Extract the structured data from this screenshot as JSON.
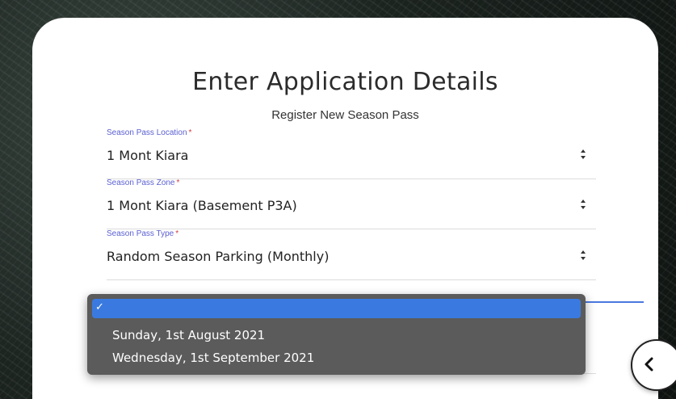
{
  "form": {
    "title": "Enter Application Details",
    "subtitle": "Register New Season Pass",
    "required_marker": "*",
    "fields": [
      {
        "label": "Season Pass Location",
        "value": "1 Mont Kiara"
      },
      {
        "label": "Season Pass Zone",
        "value": "1 Mont Kiara (Basement P3A)"
      },
      {
        "label": "Season Pass Type",
        "value": "Random Season Parking (Monthly)"
      }
    ]
  },
  "dropdown": {
    "check_mark": "✓",
    "options": [
      {
        "label": "",
        "selected": true
      },
      {
        "label": "Sunday, 1st August 2021",
        "selected": false
      },
      {
        "label": "Wednesday, 1st September 2021",
        "selected": false
      }
    ]
  },
  "icons": {
    "select_arrows": "up-down-arrows-icon",
    "side_button": "chevron-left-icon"
  },
  "colors": {
    "label": "#5a5fd1",
    "required": "#d23b3b",
    "dropdown_bg": "#5b5b5b",
    "dropdown_selected": "#3a7ae0",
    "accent": "#4a78e0"
  }
}
